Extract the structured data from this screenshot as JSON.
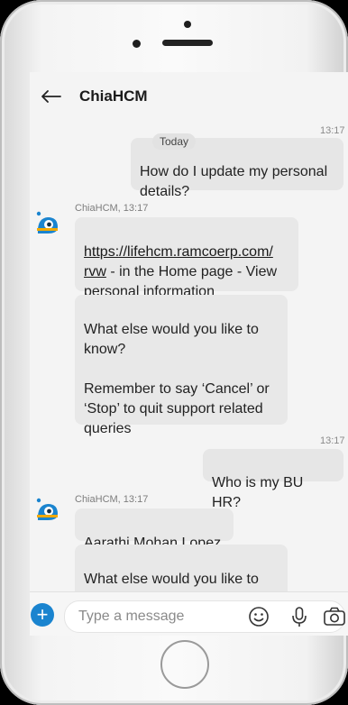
{
  "header": {
    "title": "ChiaHCM"
  },
  "chat": {
    "date_separator": "Today",
    "messages": [
      {
        "role": "user",
        "time": "13:17",
        "text": "How do I update my personal details?"
      },
      {
        "role": "bot",
        "sender": "ChiaHCM, 13:17",
        "link": "https://lifehcm.ramcoerp.com/rvw",
        "link_display_1": "https://lifehcm.ramcoerp.com/",
        "link_display_2": "rvw",
        "text_after_link": " - in the Home page - View personal information"
      },
      {
        "role": "bot",
        "text": "What else would you like to know?\n\nRemember to say ‘Cancel’ or ‘Stop’ to quit support related queries"
      },
      {
        "role": "user",
        "time": "13:17",
        "text": "Who is my BU HR?"
      },
      {
        "role": "bot",
        "sender": "ChiaHCM, 13:17",
        "text": "Aarathi Mohan Lopez"
      },
      {
        "role": "bot",
        "text": "What else would you like to know?"
      }
    ]
  },
  "composer": {
    "placeholder": "Type a message"
  },
  "icons": [
    "back-arrow-icon",
    "bot-avatar-icon",
    "plus-icon",
    "emoji-icon",
    "microphone-icon",
    "camera-icon"
  ],
  "colors": {
    "accent": "#1a84cf",
    "bubble": "#e8e8e8",
    "screen_bg": "#f4f4f4"
  }
}
